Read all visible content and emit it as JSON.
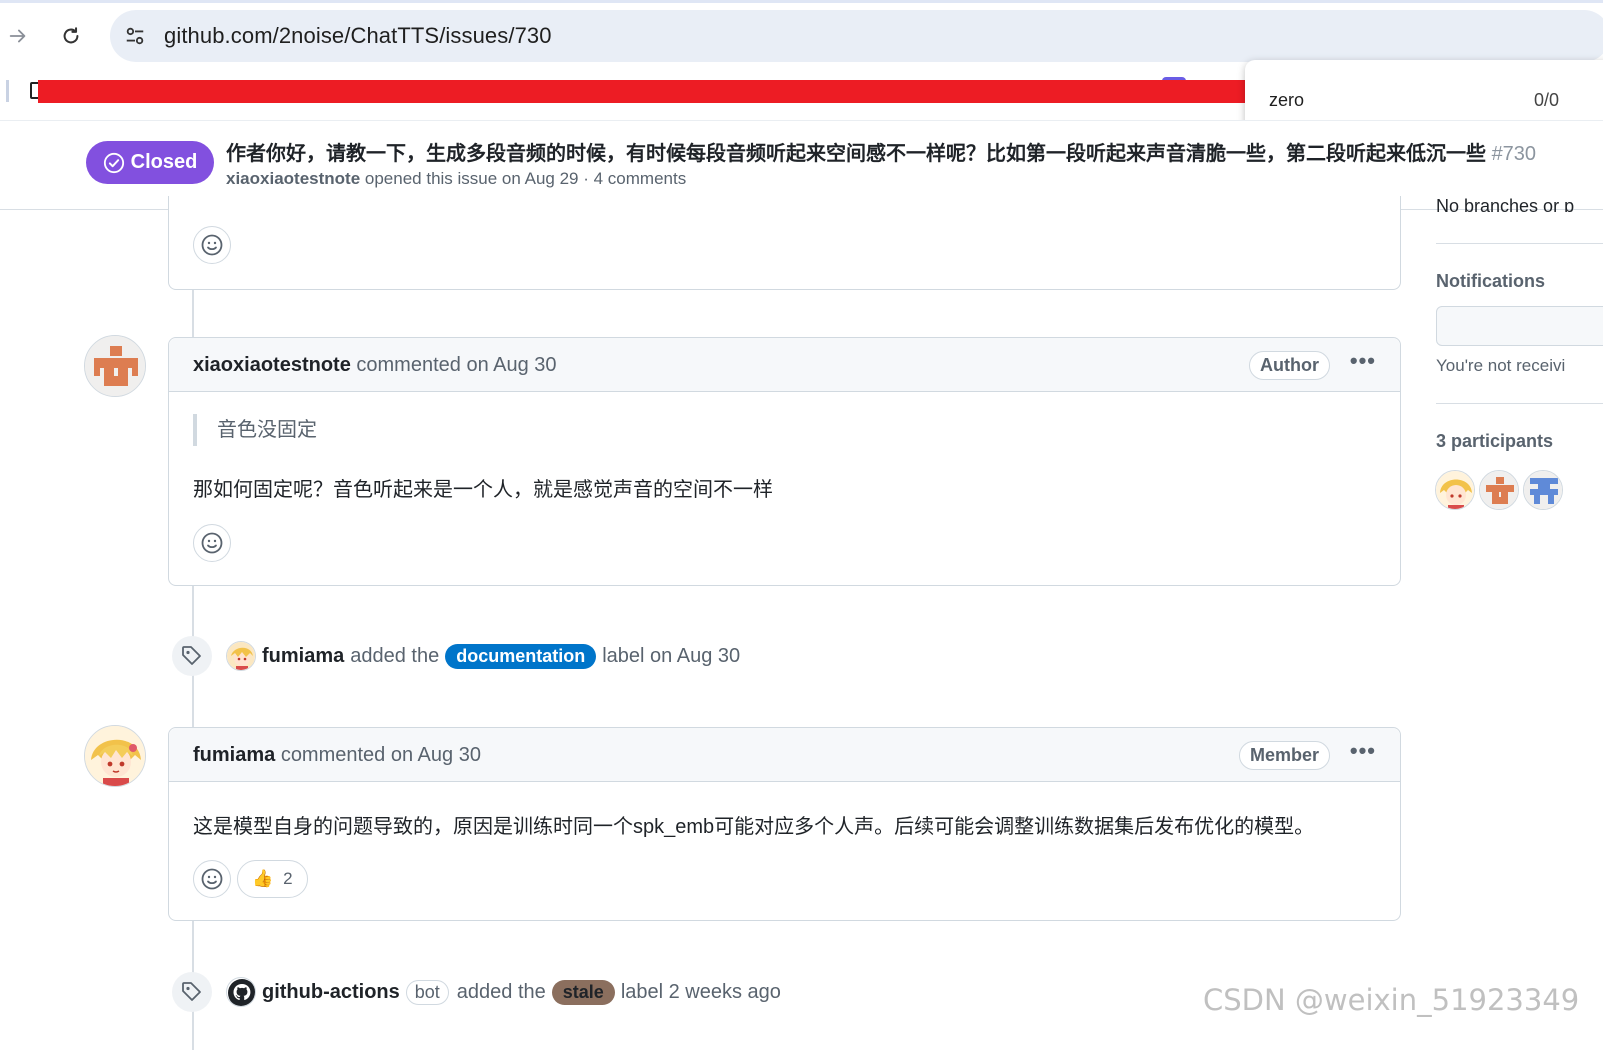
{
  "browser": {
    "url": "github.com/2noise/ChatTTS/issues/730",
    "find_query": "zero",
    "find_count": "0/0"
  },
  "issue": {
    "status": "Closed",
    "title": "作者你好，请教一下，生成多段音频的时候，有时候每段音频听起来空间感不一样呢？比如第一段听起来声音清脆一些，第二段听起来低沉一些",
    "number": "#730",
    "opener": "xiaoxiaotestnote",
    "opened_text": "opened this issue on Aug 29 · 4 comments"
  },
  "timeline": {
    "comment1": {
      "author": "xiaoxiaotestnote",
      "action": "commented on Aug 30",
      "role": "Author",
      "quote": "音色没固定",
      "body": "那如何固定呢？音色听起来是一个人，就是感觉声音的空间不一样"
    },
    "label_event1": {
      "actor": "fumiama",
      "pre": "added the",
      "label": "documentation",
      "post": "label on Aug 30",
      "label_color": "#0075ca"
    },
    "comment2": {
      "author": "fumiama",
      "action": "commented on Aug 30",
      "role": "Member",
      "body": "这是模型自身的问题导致的，原因是训练时同一个spk_emb可能对应多个人声。后续可能会调整训练数据集后发布优化的模型。",
      "reaction_emoji": "👍",
      "reaction_count": "2"
    },
    "label_event2": {
      "actor": "github-actions",
      "bot": "bot",
      "pre": "added the",
      "label": "stale",
      "post": "label 2 weeks ago",
      "label_color": "#8b6f5e"
    }
  },
  "sidebar": {
    "dev_text_partial": "No branches or p",
    "notifications_heading": "Notifications",
    "notifications_note": "You're not receivi",
    "participants_heading": "3 participants"
  },
  "watermark": "CSDN @weixin_51923349",
  "colors": {
    "closed": "#8250df",
    "redaction": "#ed1c24"
  }
}
